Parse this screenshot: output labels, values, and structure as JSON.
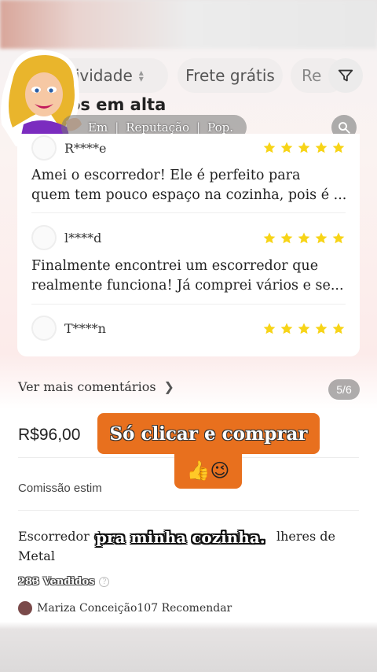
{
  "filters": {
    "activity_label": "tividade",
    "frete_label": "Frete grátis",
    "partial_label": "Re"
  },
  "section": {
    "title": "os em alta"
  },
  "sort": {
    "opt1": "Em",
    "opt2": "Reputação",
    "opt3": "Pop."
  },
  "reviews": [
    {
      "user": "R****e",
      "rating": 5,
      "text": "Amei o escorredor! Ele é perfeito para",
      "text2": "quem tem pouco espaço na cozinha, pois é ..."
    },
    {
      "user": "l****d",
      "rating": 5,
      "text": "Finalmente encontrei um escorredor que",
      "text2": "realmente funciona! Já comprei vários e se..."
    },
    {
      "user": "T****n",
      "rating": 5
    }
  ],
  "more_comments": {
    "label": "Ver mais comentários",
    "page": "5/6"
  },
  "product": {
    "price": "R$96,00",
    "commission_label": "Comissão estim",
    "title_prefix": "Escorredor d",
    "title_suffix": "lheres de",
    "title_line2": "Metal",
    "sold": "283 Vendidos",
    "recommender": "Mariza Conceição107 Recomendar"
  },
  "overlays": {
    "promo_text": "Só clicar e comprar",
    "emojis": "👍😉",
    "caption": "pra minha cozinha."
  },
  "colors": {
    "star": "#f7d417",
    "promo_bg": "#e8701e"
  }
}
